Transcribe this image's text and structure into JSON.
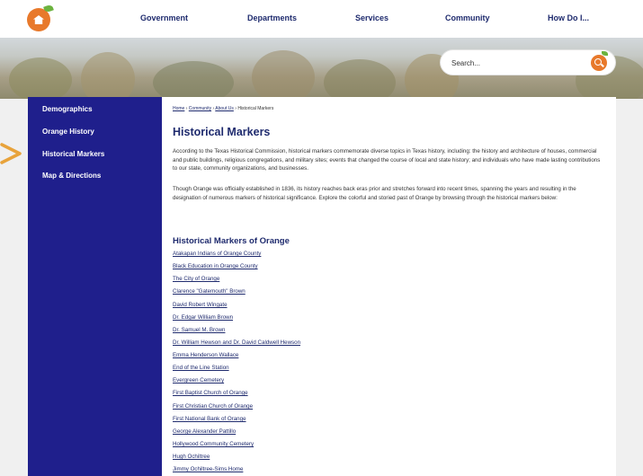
{
  "nav": {
    "items": [
      "Government",
      "Departments",
      "Services",
      "Community",
      "How Do I..."
    ]
  },
  "search": {
    "placeholder": "Search..."
  },
  "sidebar": {
    "items": [
      {
        "label": "Demographics"
      },
      {
        "label": "Orange History"
      },
      {
        "label": "Historical Markers"
      },
      {
        "label": "Map & Directions"
      }
    ]
  },
  "breadcrumb": {
    "items": [
      "Home",
      "Community",
      "About Us"
    ],
    "separator": "›",
    "current": "Historical Markers"
  },
  "page": {
    "title": "Historical Markers",
    "intro": "According to the Texas Historical Commission, historical markers commemorate diverse topics in Texas history, including: the history and architecture of houses, commercial and public buildings, religious congregations, and military sites; events that changed the course of local and state history; and individuals who have made lasting contributions to our state, community organizations, and businesses.",
    "paragraph2": "Though Orange was officially established in 1836, its history reaches back eras prior and stretches forward into recent times, spanning the years and resulting in the designation of numerous markers of historical significance. Explore the colorful and storied past of Orange by browsing through the historical markers below:",
    "section_title": "Historical Markers of Orange",
    "markers": [
      "Atakapan Indians of Orange County",
      "Black Education in Orange County",
      "The City of Orange",
      "Clarence \"Gatemouth\" Brown",
      "David Robert Wingate",
      "Dr. Edgar William Brown",
      "Dr. Samuel M. Brown",
      "Dr. William Hewson and Dr. David Caldwell Hewson",
      "Emma Henderson Wallace",
      "End of the Line Station",
      "Evergreen Cemetery",
      "First Baptist Church of Orange",
      "First Christian Church of Orange",
      "First National Bank of Orange",
      "George Alexander Pattillo",
      "Hollywood Community Cemetery",
      "Hugh Ochiltree",
      "Jimmy Ochiltree-Sims Home"
    ]
  },
  "colors": {
    "brand_orange": "#e8792b",
    "brand_green": "#6cb33f",
    "navy": "#1f2b6e",
    "sidebar_blue": "#1f1f8c"
  },
  "icons": [
    "home-logo-icon",
    "search-icon",
    "pointer-arrow-icon"
  ]
}
